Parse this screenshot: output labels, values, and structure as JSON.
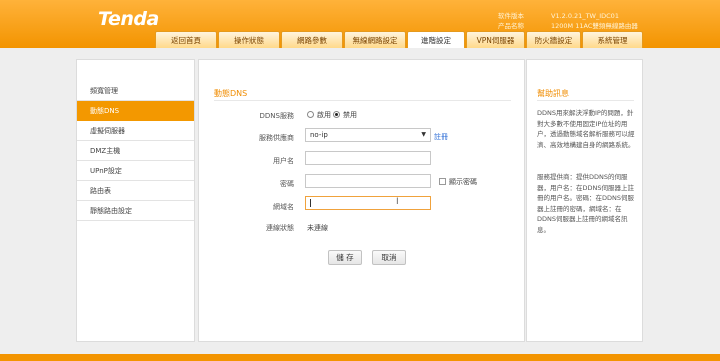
{
  "header": {
    "logo": "Tenda",
    "info_labels": [
      "软件版本",
      "产品名称"
    ],
    "info_values": [
      "V1.2.0.21_TW_IDC01",
      "1200M 11AC雙頻無線路由器"
    ]
  },
  "nav": {
    "tabs": [
      {
        "label": "返回首頁"
      },
      {
        "label": "操作狀態"
      },
      {
        "label": "網路參數"
      },
      {
        "label": "無線網路設定"
      },
      {
        "label": "進階設定"
      },
      {
        "label": "VPN伺服器"
      },
      {
        "label": "防火牆設定"
      },
      {
        "label": "系統管理"
      }
    ],
    "active_index": 4
  },
  "sidebar": {
    "items": [
      {
        "label": "頻寬管理"
      },
      {
        "label": "動態DNS"
      },
      {
        "label": "虛擬伺服器"
      },
      {
        "label": "DMZ主機"
      },
      {
        "label": "UPnP設定"
      },
      {
        "label": "路由表"
      },
      {
        "label": "靜態路由設定"
      }
    ],
    "active_index": 1
  },
  "form": {
    "title": "動態DNS",
    "ddns_label": "DDNS服務",
    "ddns_options": [
      "啟用",
      "禁用"
    ],
    "ddns_selected": "禁用",
    "provider_label": "服務供應商",
    "provider_value": "no-ip",
    "register_link": "註冊",
    "username_label": "用户名",
    "username_value": "",
    "password_label": "密碼",
    "password_value": "",
    "show_password_label": "顯示密碼",
    "domain_label": "網域名",
    "domain_value": "",
    "status_label": "連線狀態",
    "status_value": "未連線",
    "save_label": "儲 存",
    "cancel_label": "取消"
  },
  "help": {
    "title": "幫助訊息",
    "para1": "DDNS用來解決浮動IP的問題，針對大多數不使用固定IP位址的用户，透過動態域名解析服務可以經濟、高效地構建自身的網路系統。",
    "para2": "服務提供商：提供DDNS的伺服器，用户名：在DDNS伺服器上註冊的用户名。密碼：在DDNS伺服器上註冊的密碼，網域名：在DDNS伺服器上註冊的網域名訊息。"
  },
  "colors": {
    "brand_orange": "#f39400",
    "accent_title": "#f08c00",
    "link_blue": "#2a6bd6"
  }
}
